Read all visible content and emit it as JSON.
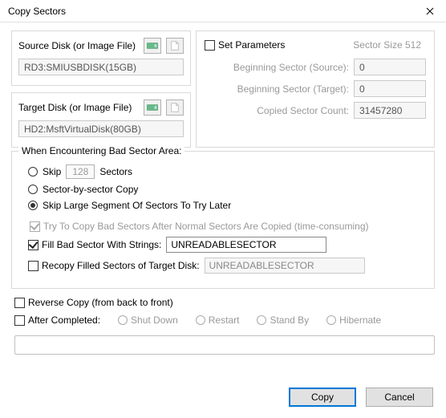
{
  "window": {
    "title": "Copy Sectors"
  },
  "source": {
    "label": "Source Disk (or Image File)",
    "value": "RD3:SMIUSBDISK(15GB)"
  },
  "target": {
    "label": "Target Disk (or Image File)",
    "value": "HD2:MsftVirtualDisk(80GB)"
  },
  "params": {
    "set_label": "Set Parameters",
    "sector_size": "Sector Size 512",
    "rows": {
      "beg_src_lbl": "Beginning Sector (Source):",
      "beg_src_val": "0",
      "beg_tgt_lbl": "Beginning Sector (Target):",
      "beg_tgt_val": "0",
      "count_lbl": "Copied Sector Count:",
      "count_val": "31457280"
    }
  },
  "bad": {
    "legend": "When Encountering Bad Sector Area:",
    "skip_lbl": "Skip",
    "skip_num": "128",
    "skip_unit": "Sectors",
    "sbs": "Sector-by-sector Copy",
    "skip_large": "Skip Large Segment Of Sectors To Try Later",
    "try_copy": "Try To Copy Bad Sectors After Normal Sectors Are Copied (time-consuming)",
    "fill_lbl": "Fill Bad Sector With Strings:",
    "fill_val": "UNREADABLESECTOR",
    "recopy_lbl": "Recopy Filled Sectors of Target Disk:",
    "recopy_val": "UNREADABLESECTOR"
  },
  "reverse": "Reverse Copy (from back to front)",
  "after": {
    "label": "After Completed:",
    "opts": [
      "Shut Down",
      "Restart",
      "Stand By",
      "Hibernate"
    ]
  },
  "buttons": {
    "copy": "Copy",
    "cancel": "Cancel"
  }
}
